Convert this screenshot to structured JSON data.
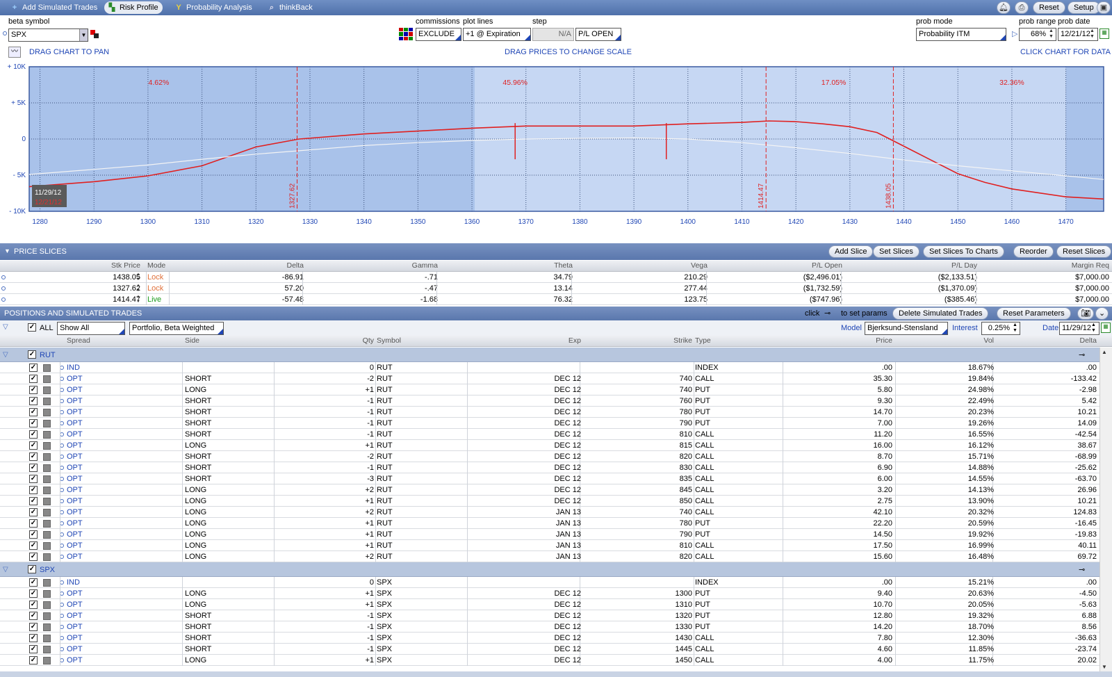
{
  "toolbar": {
    "tabs": [
      {
        "label": "Add Simulated Trades",
        "icon": "plus-icon"
      },
      {
        "label": "Risk Profile",
        "icon": "risk-profile-icon"
      },
      {
        "label": "Probability Analysis",
        "icon": "probability-icon"
      },
      {
        "label": "thinkBack",
        "icon": "thinkback-icon"
      }
    ],
    "reset": "Reset",
    "setup": "Setup"
  },
  "controls": {
    "beta_symbol_label": "beta symbol",
    "beta_symbol": "SPX",
    "commissions_label": "commissions",
    "commissions": "EXCLUDE",
    "plot_lines_label": "plot lines",
    "plot_lines": "+1 @ Expiration",
    "step_label": "step",
    "step": "N/A",
    "pl_mode": "P/L OPEN",
    "prob_mode_label": "prob mode",
    "prob_mode": "Probability ITM",
    "prob_range_label": "prob range",
    "prob_range": "68%",
    "prob_date_label": "prob date",
    "prob_date": "12/21/12",
    "drag_pan": "DRAG CHART TO PAN",
    "drag_prices": "DRAG PRICES TO CHANGE SCALE",
    "click_chart": "CLICK CHART FOR DATA"
  },
  "chart_data": {
    "type": "line",
    "xlim": [
      1278,
      1477
    ],
    "ylim": [
      -10000,
      10000
    ],
    "x_ticks": [
      1280,
      1290,
      1300,
      1310,
      1320,
      1330,
      1340,
      1350,
      1360,
      1370,
      1380,
      1390,
      1400,
      1410,
      1420,
      1430,
      1440,
      1450,
      1460,
      1470
    ],
    "y_ticks": [
      {
        "v": 10000,
        "l": "+ 10K"
      },
      {
        "v": 5000,
        "l": "+ 5K"
      },
      {
        "v": 0,
        "l": "0"
      },
      {
        "v": -5000,
        "l": "- 5K"
      },
      {
        "v": -10000,
        "l": "- 10K"
      }
    ],
    "prob_bands": [
      {
        "from": 1278,
        "to": 1360.5,
        "label": "4.62%",
        "lx": 1302
      },
      {
        "from": 1360.5,
        "to": 1414.47,
        "label": "45.96%",
        "lx": 1368
      },
      {
        "from": 1414.47,
        "to": 1438.05,
        "label": "17.05%",
        "lx": 1427
      },
      {
        "from": 1438.05,
        "to": 1477,
        "label": "32.36%",
        "lx": 1460
      }
    ],
    "slice_lines": [
      {
        "x": 1327.62,
        "label": "1327.62"
      },
      {
        "x": 1414.47,
        "label": "1414.47"
      },
      {
        "x": 1438.05,
        "label": "1438.05"
      }
    ],
    "strike_marks": [
      1368,
      1396
    ],
    "series": [
      {
        "name": "",
        "color": "#e02020",
        "x": [
          1278,
          1290,
          1300,
          1310,
          1320,
          1328,
          1340,
          1350,
          1360,
          1370,
          1380,
          1390,
          1400,
          1410,
          1415,
          1420,
          1425,
          1430,
          1435,
          1440,
          1445,
          1450,
          1455,
          1460,
          1470,
          1477
        ],
        "y": [
          -6600,
          -5900,
          -5100,
          -3700,
          -1100,
          0,
          700,
          1100,
          1500,
          1800,
          1800,
          1800,
          2100,
          2300,
          2500,
          2400,
          2100,
          1700,
          900,
          -1000,
          -2900,
          -4800,
          -6000,
          -6900,
          -8000,
          -8300
        ]
      },
      {
        "name": "",
        "color": "#f4f4f4",
        "x": [
          1278,
          1290,
          1300,
          1310,
          1320,
          1330,
          1340,
          1350,
          1360,
          1370,
          1380,
          1390,
          1400,
          1410,
          1420,
          1430,
          1440,
          1450,
          1460,
          1470,
          1477
        ],
        "y": [
          -4900,
          -4200,
          -3600,
          -2800,
          -2100,
          -1500,
          -900,
          -500,
          -200,
          0,
          100,
          150,
          0,
          -500,
          -1200,
          -2000,
          -2900,
          -3700,
          -4400,
          -5100,
          -5600
        ]
      }
    ],
    "date_labels": [
      "11/29/12",
      "12/21/12"
    ]
  },
  "price_slices": {
    "title": "PRICE SLICES",
    "buttons": [
      "Add Slice",
      "Set Slices",
      "Set Slices To Charts",
      "Reorder",
      "Reset Slices"
    ],
    "headers": [
      "Stk Price",
      "Mode",
      "Delta",
      "Gamma",
      "Theta",
      "Vega",
      "P/L Open",
      "P/L Day",
      "Margin Req"
    ],
    "rows": [
      [
        "1438.05",
        "Lock",
        "-86.91",
        "-.71",
        "34.79",
        "210.29",
        "($2,496.01)",
        "($2,133.51)",
        "$7,000.00"
      ],
      [
        "1327.62",
        "Lock",
        "57.20",
        "-.47",
        "13.14",
        "277.44",
        "($1,732.59)",
        "($1,370.09)",
        "$7,000.00"
      ],
      [
        "1414.47",
        "Live",
        "-57.48",
        "-1.68",
        "76.32",
        "123.75",
        "($747.96)",
        "($385.46)",
        "$7,000.00"
      ]
    ]
  },
  "positions": {
    "title": "POSITIONS AND SIMULATED TRADES",
    "click_text": "click",
    "params_text": "to set params",
    "delete_btn": "Delete Simulated Trades",
    "reset_btn": "Reset Parameters",
    "all_label": "ALL",
    "show_all": "Show All",
    "portfolio": "Portfolio, Beta Weighted",
    "model_label": "Model",
    "model": "Bjerksund-Stensland",
    "interest_label": "Interest",
    "interest": "0.25%",
    "date_label": "Date",
    "date": "11/29/12",
    "headers": [
      "Spread",
      "Side",
      "Qty",
      "Symbol",
      "Exp",
      "Strike",
      "Type",
      "Price",
      "Vol",
      "Delta"
    ],
    "groups": [
      {
        "name": "RUT",
        "rows": [
          [
            "IND",
            "",
            "0",
            "RUT",
            "",
            "",
            "INDEX",
            ".00",
            "18.67%",
            ".00"
          ],
          [
            "OPT",
            "SHORT",
            "-2",
            "RUT",
            "DEC 12",
            "740",
            "CALL",
            "35.30",
            "19.84%",
            "-133.42"
          ],
          [
            "OPT",
            "LONG",
            "+1",
            "RUT",
            "DEC 12",
            "740",
            "PUT",
            "5.80",
            "24.98%",
            "-2.98"
          ],
          [
            "OPT",
            "SHORT",
            "-1",
            "RUT",
            "DEC 12",
            "760",
            "PUT",
            "9.30",
            "22.49%",
            "5.42"
          ],
          [
            "OPT",
            "SHORT",
            "-1",
            "RUT",
            "DEC 12",
            "780",
            "PUT",
            "14.70",
            "20.23%",
            "10.21"
          ],
          [
            "OPT",
            "SHORT",
            "-1",
            "RUT",
            "DEC 12",
            "790",
            "PUT",
            "7.00",
            "19.26%",
            "14.09"
          ],
          [
            "OPT",
            "SHORT",
            "-1",
            "RUT",
            "DEC 12",
            "810",
            "CALL",
            "11.20",
            "16.55%",
            "-42.54"
          ],
          [
            "OPT",
            "LONG",
            "+1",
            "RUT",
            "DEC 12",
            "815",
            "CALL",
            "16.00",
            "16.12%",
            "38.67"
          ],
          [
            "OPT",
            "SHORT",
            "-2",
            "RUT",
            "DEC 12",
            "820",
            "CALL",
            "8.70",
            "15.71%",
            "-68.99"
          ],
          [
            "OPT",
            "SHORT",
            "-1",
            "RUT",
            "DEC 12",
            "830",
            "CALL",
            "6.90",
            "14.88%",
            "-25.62"
          ],
          [
            "OPT",
            "SHORT",
            "-3",
            "RUT",
            "DEC 12",
            "835",
            "CALL",
            "6.00",
            "14.55%",
            "-63.70"
          ],
          [
            "OPT",
            "LONG",
            "+2",
            "RUT",
            "DEC 12",
            "845",
            "CALL",
            "3.20",
            "14.13%",
            "26.96"
          ],
          [
            "OPT",
            "LONG",
            "+1",
            "RUT",
            "DEC 12",
            "850",
            "CALL",
            "2.75",
            "13.90%",
            "10.21"
          ],
          [
            "OPT",
            "LONG",
            "+2",
            "RUT",
            "JAN 13",
            "740",
            "CALL",
            "42.10",
            "20.32%",
            "124.83"
          ],
          [
            "OPT",
            "LONG",
            "+1",
            "RUT",
            "JAN 13",
            "780",
            "PUT",
            "22.20",
            "20.59%",
            "-16.45"
          ],
          [
            "OPT",
            "LONG",
            "+1",
            "RUT",
            "JAN 13",
            "790",
            "PUT",
            "14.50",
            "19.92%",
            "-19.83"
          ],
          [
            "OPT",
            "LONG",
            "+1",
            "RUT",
            "JAN 13",
            "810",
            "CALL",
            "17.50",
            "16.99%",
            "40.11"
          ],
          [
            "OPT",
            "LONG",
            "+2",
            "RUT",
            "JAN 13",
            "820",
            "CALL",
            "15.60",
            "16.48%",
            "69.72"
          ]
        ]
      },
      {
        "name": "SPX",
        "rows": [
          [
            "IND",
            "",
            "0",
            "SPX",
            "",
            "",
            "INDEX",
            ".00",
            "15.21%",
            ".00"
          ],
          [
            "OPT",
            "LONG",
            "+1",
            "SPX",
            "DEC 12",
            "1300",
            "PUT",
            "9.40",
            "20.63%",
            "-4.50"
          ],
          [
            "OPT",
            "LONG",
            "+1",
            "SPX",
            "DEC 12",
            "1310",
            "PUT",
            "10.70",
            "20.05%",
            "-5.63"
          ],
          [
            "OPT",
            "SHORT",
            "-1",
            "SPX",
            "DEC 12",
            "1320",
            "PUT",
            "12.80",
            "19.32%",
            "6.88"
          ],
          [
            "OPT",
            "SHORT",
            "-1",
            "SPX",
            "DEC 12",
            "1330",
            "PUT",
            "14.20",
            "18.70%",
            "8.56"
          ],
          [
            "OPT",
            "SHORT",
            "-1",
            "SPX",
            "DEC 12",
            "1430",
            "CALL",
            "7.80",
            "12.30%",
            "-36.63"
          ],
          [
            "OPT",
            "SHORT",
            "-1",
            "SPX",
            "DEC 12",
            "1445",
            "CALL",
            "4.60",
            "11.85%",
            "-23.74"
          ],
          [
            "OPT",
            "LONG",
            "+1",
            "SPX",
            "DEC 12",
            "1450",
            "CALL",
            "4.00",
            "11.75%",
            "20.02"
          ]
        ]
      }
    ]
  }
}
